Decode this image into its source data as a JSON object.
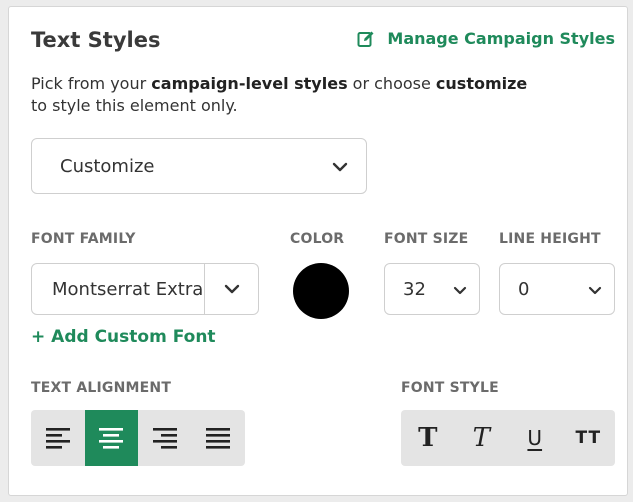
{
  "panel": {
    "title": "Text Styles",
    "manage_link": "Manage Campaign Styles"
  },
  "description": {
    "part1": "Pick from your ",
    "bold1": "campaign-level styles",
    "part2": " or choose ",
    "bold2": "customize",
    "part3": " to style this element only."
  },
  "style_select": {
    "value": "Customize"
  },
  "labels": {
    "font_family": "FONT FAMILY",
    "color": "COLOR",
    "font_size": "FONT SIZE",
    "line_height": "LINE HEIGHT",
    "text_alignment": "TEXT ALIGNMENT",
    "font_style": "FONT STYLE"
  },
  "font_family": {
    "value": "Montserrat Extra Bold"
  },
  "color": {
    "value": "#000000"
  },
  "font_size": {
    "value": "32"
  },
  "line_height": {
    "value": "0"
  },
  "add_font": {
    "label": "+ Add Custom Font"
  },
  "alignment": {
    "options": [
      "left",
      "center",
      "right",
      "justify"
    ],
    "selected": "center"
  },
  "font_style": {
    "bold": "T",
    "italic": "T",
    "underline": "U",
    "caps": "TT"
  },
  "colors": {
    "accent": "#1f8a5b",
    "group_bg": "#e4e4e4"
  },
  "icons": [
    "edit-icon",
    "chevron-down-icon",
    "align-left-icon",
    "align-center-icon",
    "align-right-icon",
    "align-justify-icon"
  ]
}
